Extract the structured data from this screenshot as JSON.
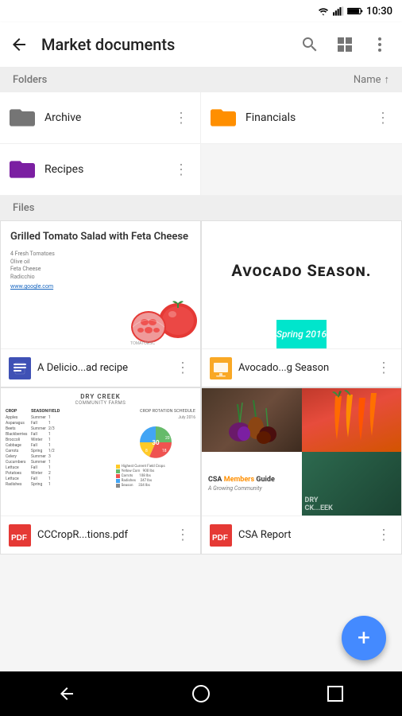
{
  "statusBar": {
    "time": "10:30",
    "icons": [
      "signal",
      "wifi",
      "battery"
    ]
  },
  "appBar": {
    "title": "Market documents",
    "backLabel": "back",
    "searchLabel": "search",
    "gridLabel": "grid view",
    "moreLabel": "more options"
  },
  "foldersHeader": {
    "label": "Folders",
    "sortLabel": "Name",
    "sortIcon": "↑"
  },
  "folders": [
    {
      "name": "Archive",
      "color": "#757575",
      "hasColor": false
    },
    {
      "name": "Financials",
      "color": "#FF8F00",
      "hasColor": true
    },
    {
      "name": "Recipes",
      "color": "#7B1FA2",
      "hasColor": true
    },
    {
      "name": "",
      "empty": true
    }
  ],
  "filesHeader": {
    "label": "Files"
  },
  "files": [
    {
      "id": "tomato",
      "name": "A Delicio...ad recipe",
      "typeIcon": "document",
      "typeColor": "#3F51B5",
      "previewTitle": "Grilled Tomato Salad with Feta Cheese",
      "previewIngredients": "4 Fresh Tomatoes\nOlive oil\nFeta Cheese\nRadicchio",
      "previewLink": "www.google.com",
      "previewNote": "TOMATOESC"
    },
    {
      "id": "avocado",
      "name": "Avocado...g Season",
      "typeIcon": "slides",
      "typeColor": "#F9A825",
      "previewTitle": "Avocado Season.",
      "bannerText": "Spring 2016"
    },
    {
      "id": "crop",
      "name": "CCCropR...tions.pdf",
      "typeIcon": "pdf",
      "typeColor": "#E53935",
      "previewFarmName": "DRY CREEK",
      "previewFarmSub": "COMMUNITY FARMS",
      "previewChartTitle": "CROP ROTATION SCHEDULE",
      "previewMonth": "July 2016"
    },
    {
      "id": "csa",
      "name": "CSA Report",
      "typeIcon": "pdf",
      "typeColor": "#E53935",
      "previewTitle": "CSA Members Guide",
      "previewSubtitle": "A Growing Community",
      "dkText": "DRY CK...EEK"
    }
  ],
  "fab": {
    "label": "+"
  },
  "bottomNav": {
    "backBtn": "◁",
    "homeBtn": "○",
    "recentBtn": "□"
  }
}
